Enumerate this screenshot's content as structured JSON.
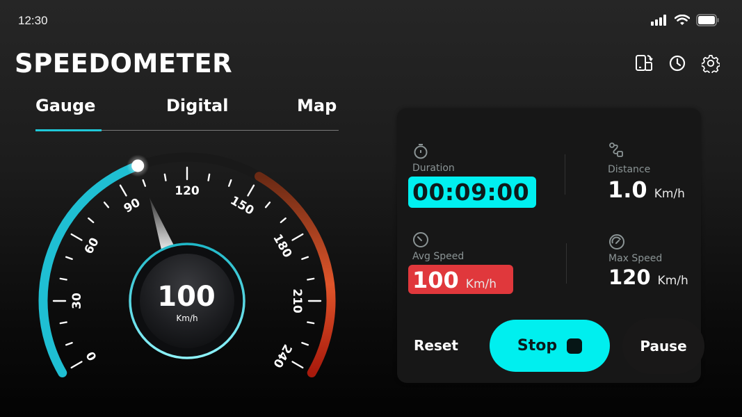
{
  "status_bar": {
    "time": "12:30",
    "icons": [
      "signal-icon",
      "wifi-icon",
      "battery-icon"
    ]
  },
  "header": {
    "title": "SPEEDOMETER",
    "actions": [
      {
        "name": "rotate-screen-icon",
        "label": "Rotate screen"
      },
      {
        "name": "history-icon",
        "label": "History"
      },
      {
        "name": "settings-icon",
        "label": "Settings"
      }
    ]
  },
  "tabs": [
    {
      "label": "Gauge",
      "active": true
    },
    {
      "label": "Digital",
      "active": false
    },
    {
      "label": "Map",
      "active": false
    }
  ],
  "gauge": {
    "speed": 100,
    "unit": "Km/h",
    "min": 0,
    "max": 240,
    "major_ticks": [
      0,
      30,
      60,
      90,
      120,
      150,
      180,
      210,
      240
    ],
    "minor_step": 10,
    "colors": {
      "progress": "#1fbfd3",
      "track": "#191919",
      "hot_start": "#6a2a14",
      "hot_mid": "#e0552a",
      "hot_end": "#a81a0c",
      "center_ring": "#3fd5e2"
    },
    "hot_zone_start": 150
  },
  "stats": {
    "duration": {
      "label": "Duration",
      "value": "00:09:00",
      "icon": "stopwatch-icon",
      "highlight": "#00f0f0"
    },
    "distance": {
      "label": "Distance",
      "value": "1.0",
      "unit": "Km/h",
      "icon": "route-icon"
    },
    "avg_speed": {
      "label": "Avg Speed",
      "value": "100",
      "unit": "Km/h",
      "icon": "speed-dial-icon",
      "highlight": "#e0383c"
    },
    "max_speed": {
      "label": "Max Speed",
      "value": "120",
      "unit": "Km/h",
      "icon": "gauge-icon"
    }
  },
  "controls": {
    "reset_label": "Reset",
    "stop_label": "Stop",
    "pause_label": "Pause"
  }
}
